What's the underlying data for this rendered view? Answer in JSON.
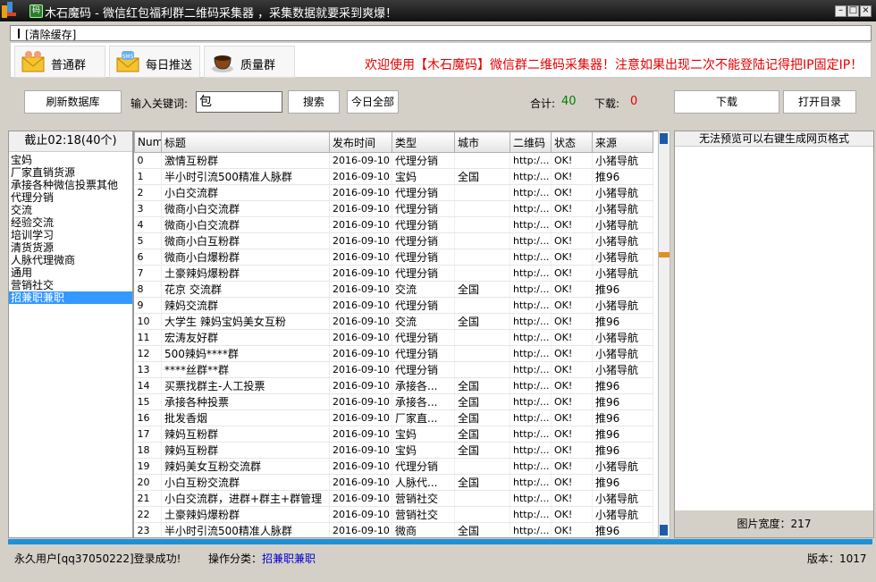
{
  "window": {
    "title": "木石魔码 - 微信红包福利群二维码采集器 ，采集数据就要采到爽爆！",
    "app_icon_glyph": "码"
  },
  "menu": {
    "clear_cache": "[清除缓存]"
  },
  "tabs": [
    {
      "label": "普通群",
      "icon": "envelope-people-icon"
    },
    {
      "label": "每日推送",
      "icon": "sms-envelope-icon"
    },
    {
      "label": "质量群",
      "icon": "coffee-cup-icon"
    }
  ],
  "welcome": "欢迎使用【木石魔码】微信群二维码采集器！注意如果出现二次不能登陆记得把IP固定IP！",
  "toolbar": {
    "refresh": "刷新数据库",
    "keyword_label": "输入关键词:",
    "keyword_value": "包",
    "search": "搜索",
    "today_all": "今日全部",
    "total_label": "合计:",
    "total_value": "40",
    "download_label": "下载:",
    "download_value": "0",
    "download_btn": "下载",
    "open_dir": "打开目录"
  },
  "left": {
    "header": "截止02:18(40个)",
    "categories": [
      "宝妈",
      "厂家直销货源",
      "承接各种微信投票其他",
      "代理分销",
      "交流",
      "经验交流",
      "培训学习",
      "清货货源",
      "人脉代理微商",
      "通用",
      "营销社交",
      "招兼职兼职"
    ],
    "selected_index": 11
  },
  "table": {
    "columns": [
      "Num",
      "标题",
      "发布时间",
      "类型",
      "城市",
      "二维码",
      "状态",
      "来源"
    ],
    "rows": [
      [
        "0",
        "激情互粉群",
        "2016-09-10",
        "代理分销",
        "",
        "http:/...",
        "OK!",
        "小猪导航"
      ],
      [
        "1",
        "半小时引流500精准人脉群",
        "2016-09-10",
        "宝妈",
        "全国",
        "http:/...",
        "OK!",
        "推96"
      ],
      [
        "2",
        "小白交流群",
        "2016-09-10",
        "代理分销",
        "",
        "http:/...",
        "OK!",
        "小猪导航"
      ],
      [
        "3",
        "微商小白交流群",
        "2016-09-10",
        "代理分销",
        "",
        "http:/...",
        "OK!",
        "小猪导航"
      ],
      [
        "4",
        "微商小白交流群",
        "2016-09-10",
        "代理分销",
        "",
        "http:/...",
        "OK!",
        "小猪导航"
      ],
      [
        "5",
        "微商小白互粉群",
        "2016-09-10",
        "代理分销",
        "",
        "http:/...",
        "OK!",
        "小猪导航"
      ],
      [
        "6",
        "微商小白爆粉群",
        "2016-09-10",
        "代理分销",
        "",
        "http:/...",
        "OK!",
        "小猪导航"
      ],
      [
        "7",
        "土豪辣妈爆粉群",
        "2016-09-10",
        "代理分销",
        "",
        "http:/...",
        "OK!",
        "小猪导航"
      ],
      [
        "8",
        "花京 交流群",
        "2016-09-10",
        "交流",
        "全国",
        "http:/...",
        "OK!",
        "推96"
      ],
      [
        "9",
        "辣妈交流群",
        "2016-09-10",
        "代理分销",
        "",
        "http:/...",
        "OK!",
        "小猪导航"
      ],
      [
        "10",
        "大学生 辣妈宝妈美女互粉",
        "2016-09-10",
        "交流",
        "全国",
        "http:/...",
        "OK!",
        "推96"
      ],
      [
        "11",
        "宏涛友好群",
        "2016-09-10",
        "代理分销",
        "",
        "http:/...",
        "OK!",
        "小猪导航"
      ],
      [
        "12",
        "500辣妈****群",
        "2016-09-10",
        "代理分销",
        "",
        "http:/...",
        "OK!",
        "小猪导航"
      ],
      [
        "13",
        "****丝群**群",
        "2016-09-10",
        "代理分销",
        "",
        "http:/...",
        "OK!",
        "小猪导航"
      ],
      [
        "14",
        "买票找群主-人工投票",
        "2016-09-10",
        "承接各...",
        "全国",
        "http:/...",
        "OK!",
        "推96"
      ],
      [
        "15",
        "承接各种投票",
        "2016-09-10",
        "承接各...",
        "全国",
        "http:/...",
        "OK!",
        "推96"
      ],
      [
        "16",
        "批发香烟",
        "2016-09-10",
        "厂家直...",
        "全国",
        "http:/...",
        "OK!",
        "推96"
      ],
      [
        "17",
        "辣妈互粉群",
        "2016-09-10",
        "宝妈",
        "全国",
        "http:/...",
        "OK!",
        "推96"
      ],
      [
        "18",
        "辣妈互粉群",
        "2016-09-10",
        "宝妈",
        "全国",
        "http:/...",
        "OK!",
        "推96"
      ],
      [
        "19",
        "辣妈美女互粉交流群",
        "2016-09-10",
        "代理分销",
        "",
        "http:/...",
        "OK!",
        "小猪导航"
      ],
      [
        "20",
        "小白互粉交流群",
        "2016-09-10",
        "人脉代...",
        "全国",
        "http:/...",
        "OK!",
        "推96"
      ],
      [
        "21",
        "小白交流群，进群+群主+群管理",
        "2016-09-10",
        "营销社交",
        "",
        "http:/...",
        "OK!",
        "小猪导航"
      ],
      [
        "22",
        "土豪辣妈爆粉群",
        "2016-09-10",
        "营销社交",
        "",
        "http:/...",
        "OK!",
        "小猪导航"
      ],
      [
        "23",
        "半小时引流500精准人脉群",
        "2016-09-10",
        "微商",
        "全国",
        "http:/...",
        "OK!",
        "推96"
      ]
    ]
  },
  "right": {
    "header": "无法预览可以右键生成网页格式",
    "image_width_label": "图片宽度：217"
  },
  "status": {
    "user": "永久用户[qq37050222]登录成功!",
    "op_label": "操作分类：",
    "op_value": "招兼职兼职",
    "version": "版本：1017"
  },
  "colors": {
    "accent": "#1e90d8",
    "welcome": "#e60000",
    "total": "#008000",
    "download": "#e60000",
    "selected": "#3399ff"
  }
}
